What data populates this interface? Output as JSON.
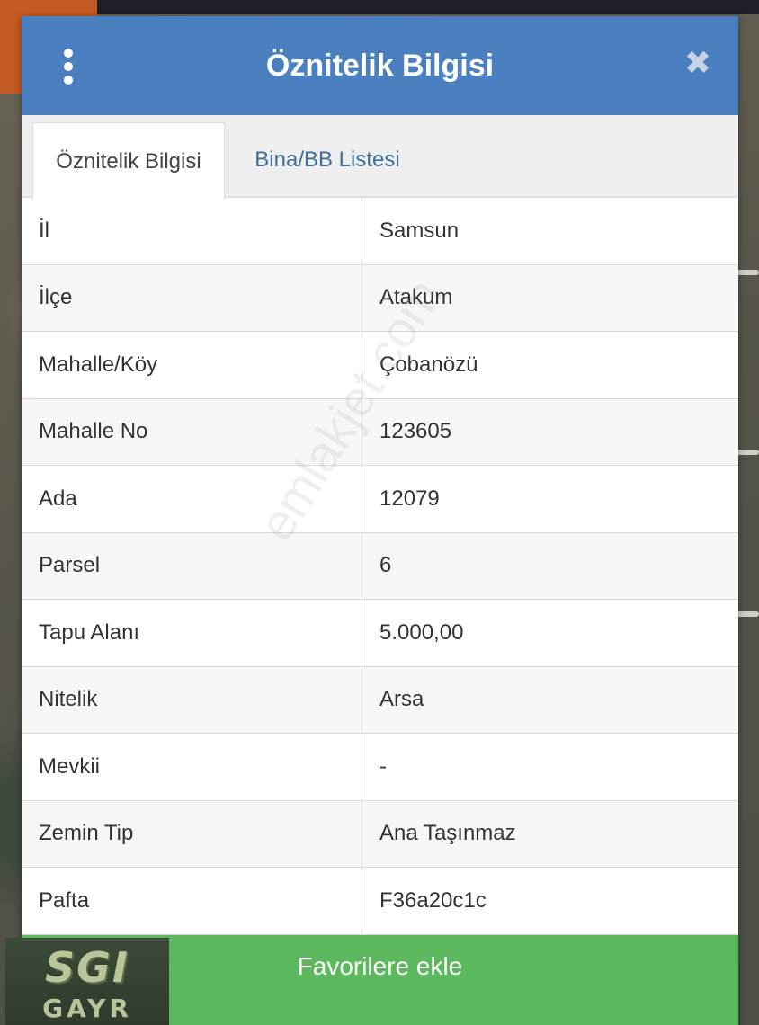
{
  "dialog": {
    "title": "Öznitelik Bilgisi",
    "menu_icon": "vertical-dots-icon",
    "close_icon": "close-icon",
    "close_glyph": "✖"
  },
  "tabs": [
    {
      "label": "Öznitelik Bilgisi",
      "active": true
    },
    {
      "label": "Bina/BB Listesi",
      "active": false
    }
  ],
  "rows": [
    {
      "key": "İl",
      "value": "Samsun"
    },
    {
      "key": "İlçe",
      "value": "Atakum"
    },
    {
      "key": "Mahalle/Köy",
      "value": "Çobanözü"
    },
    {
      "key": "Mahalle No",
      "value": "123605"
    },
    {
      "key": "Ada",
      "value": "12079"
    },
    {
      "key": "Parsel",
      "value": "6"
    },
    {
      "key": "Tapu Alanı",
      "value": "5.000,00"
    },
    {
      "key": "Nitelik",
      "value": "Arsa"
    },
    {
      "key": "Mevkii",
      "value": "-"
    },
    {
      "key": "Zemin Tip",
      "value": "Ana Taşınmaz"
    },
    {
      "key": "Pafta",
      "value": "F36a20c1c"
    }
  ],
  "watermark": "emlakjet.com",
  "favorite_button": "Favorilere ekle",
  "logo": {
    "mark": "SGI",
    "sub": "GAYR"
  },
  "colors": {
    "header": "#4a7fc0",
    "favorite": "#5cb85c",
    "tab_inactive_text": "#3d6f9a"
  }
}
